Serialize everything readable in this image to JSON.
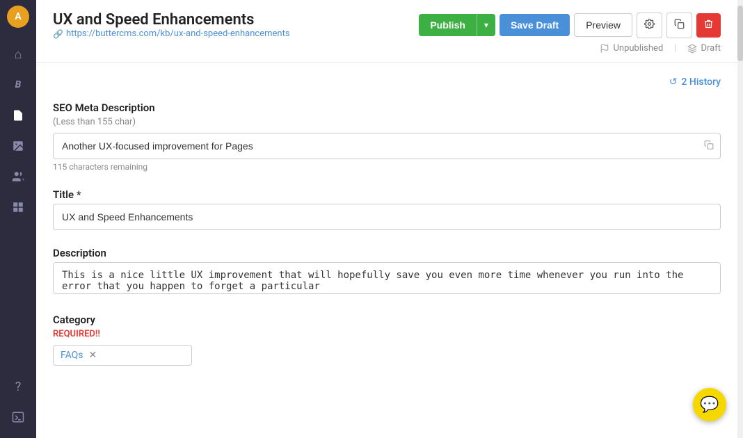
{
  "sidebar": {
    "avatar": {
      "initials": "A"
    },
    "icons": [
      {
        "name": "home-icon",
        "symbol": "⌂",
        "active": false
      },
      {
        "name": "blog-icon",
        "symbol": "ᵦ",
        "active": false
      },
      {
        "name": "pages-icon",
        "symbol": "▣",
        "active": true
      },
      {
        "name": "media-icon",
        "symbol": "◫",
        "active": false
      },
      {
        "name": "users-icon",
        "symbol": "⚇",
        "active": false
      },
      {
        "name": "collections-icon",
        "symbol": "⊞",
        "active": false
      },
      {
        "name": "help-icon",
        "symbol": "?",
        "active": false
      },
      {
        "name": "settings-icon",
        "symbol": "▤",
        "active": false
      }
    ]
  },
  "header": {
    "title": "UX and Speed Enhancements",
    "url": "https://buttercms.com/kb/ux-and-speed-enhancements",
    "url_icon": "🔗",
    "actions": {
      "publish_label": "Publish",
      "save_draft_label": "Save Draft",
      "preview_label": "Preview"
    },
    "status": {
      "unpublished_label": "Unpublished",
      "draft_label": "Draft",
      "divider": "|"
    }
  },
  "content": {
    "history_label": "History",
    "history_count": "2",
    "history_icon": "↺",
    "seo": {
      "label": "SEO Meta Description",
      "hint": "(Less than 155 char)",
      "value": "Another UX-focused improvement for Pages",
      "char_remaining": "115 characters remaining"
    },
    "title_field": {
      "label": "Title",
      "required_marker": "*",
      "value": "UX and Speed Enhancements"
    },
    "description_field": {
      "label": "Description",
      "value": "This is a nice little UX improvement that will hopefully save you even more time whenever you run into the error that you happen to forget a particular"
    },
    "category_field": {
      "label": "Category",
      "required_text": "REQUIRED!!",
      "value": "FAQs"
    }
  },
  "chat": {
    "icon": "💬"
  }
}
